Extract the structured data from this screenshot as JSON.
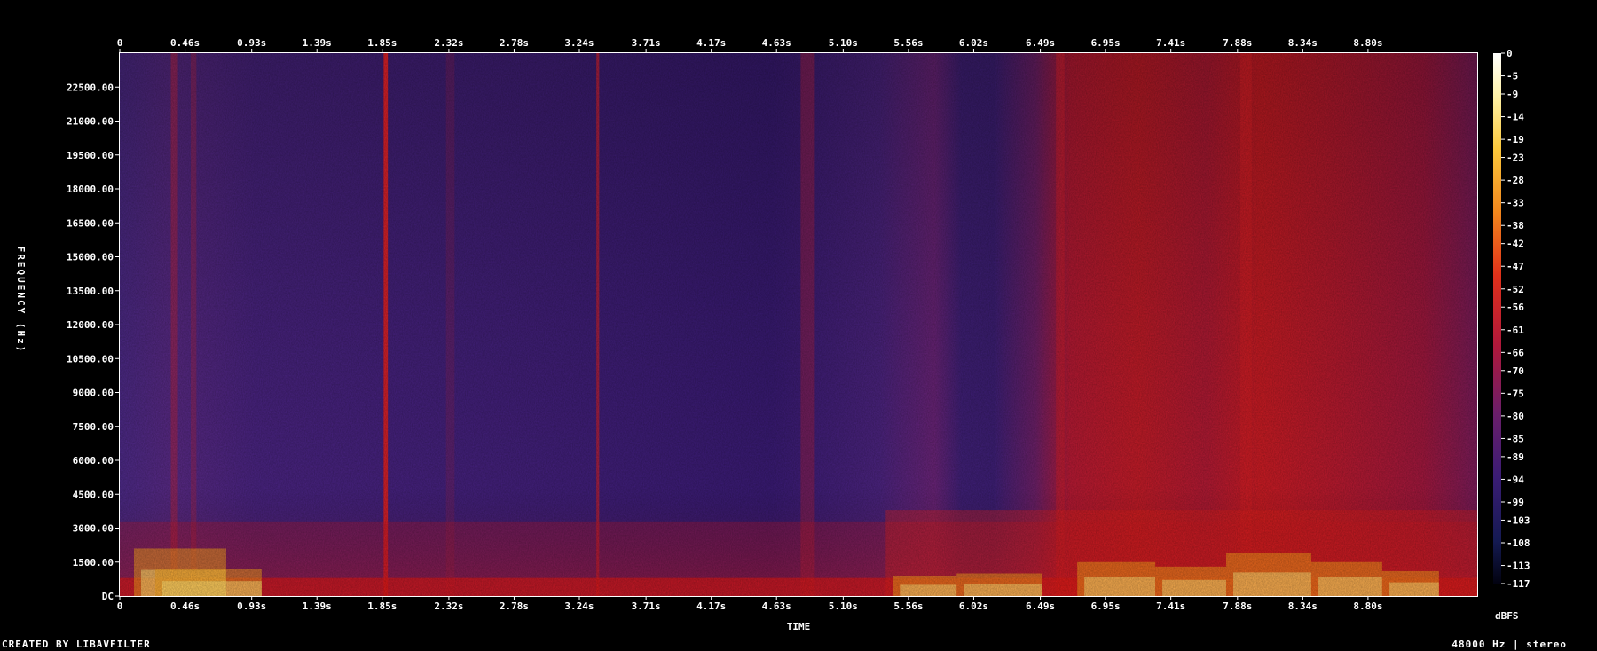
{
  "chart_data": {
    "type": "heatmap",
    "title": "",
    "xlabel": "TIME",
    "ylabel": "FREQUENCY (Hz)",
    "x_ticks": [
      "0",
      "0.46s",
      "0.93s",
      "1.39s",
      "1.85s",
      "2.32s",
      "2.78s",
      "3.24s",
      "3.71s",
      "4.17s",
      "4.63s",
      "5.10s",
      "5.56s",
      "6.02s",
      "6.49s",
      "6.95s",
      "7.41s",
      "7.88s",
      "8.34s",
      "8.80s"
    ],
    "x_tick_values": [
      0,
      0.46,
      0.93,
      1.39,
      1.85,
      2.32,
      2.78,
      3.24,
      3.71,
      4.17,
      4.63,
      5.1,
      5.56,
      6.02,
      6.49,
      6.95,
      7.41,
      7.88,
      8.34,
      8.8
    ],
    "xlim": [
      0,
      9.57
    ],
    "y_ticks": [
      "DC",
      "1500.00",
      "3000.00",
      "4500.00",
      "6000.00",
      "7500.00",
      "9000.00",
      "10500.00",
      "12000.00",
      "13500.00",
      "15000.00",
      "16500.00",
      "18000.00",
      "19500.00",
      "21000.00",
      "22500.00"
    ],
    "y_tick_values": [
      0,
      1500,
      3000,
      4500,
      6000,
      7500,
      9000,
      10500,
      12000,
      13500,
      15000,
      16500,
      18000,
      19500,
      21000,
      22500
    ],
    "ylim": [
      0,
      24000
    ],
    "colorbar": {
      "unit": "dBFS",
      "ticks": [
        "0",
        "-5",
        "-9",
        "-14",
        "-19",
        "-23",
        "-28",
        "-33",
        "-38",
        "-42",
        "-47",
        "-52",
        "-56",
        "-61",
        "-66",
        "-70",
        "-75",
        "-80",
        "-85",
        "-89",
        "-94",
        "-99",
        "-103",
        "-108",
        "-113",
        "-117"
      ],
      "tick_values": [
        0,
        -5,
        -9,
        -14,
        -19,
        -23,
        -28,
        -33,
        -38,
        -42,
        -47,
        -52,
        -56,
        -61,
        -66,
        -70,
        -75,
        -80,
        -85,
        -89,
        -94,
        -99,
        -103,
        -108,
        -113,
        -117
      ],
      "range": [
        -117,
        0
      ]
    },
    "colors": {
      "background": "#000000",
      "quiet": "#4a2480",
      "loud": "#d81818",
      "peak": "#ffe37a"
    },
    "levels_dbfs": {
      "quiet_region_0_5.4s_background": -85,
      "loud_region_5.4_9.57s_background": -55,
      "transient_1.85s": -45,
      "low_band_speech_peaks": -15
    }
  },
  "footer": {
    "left": "CREATED BY LIBAVFILTER",
    "right": "48000 Hz | stereo"
  }
}
